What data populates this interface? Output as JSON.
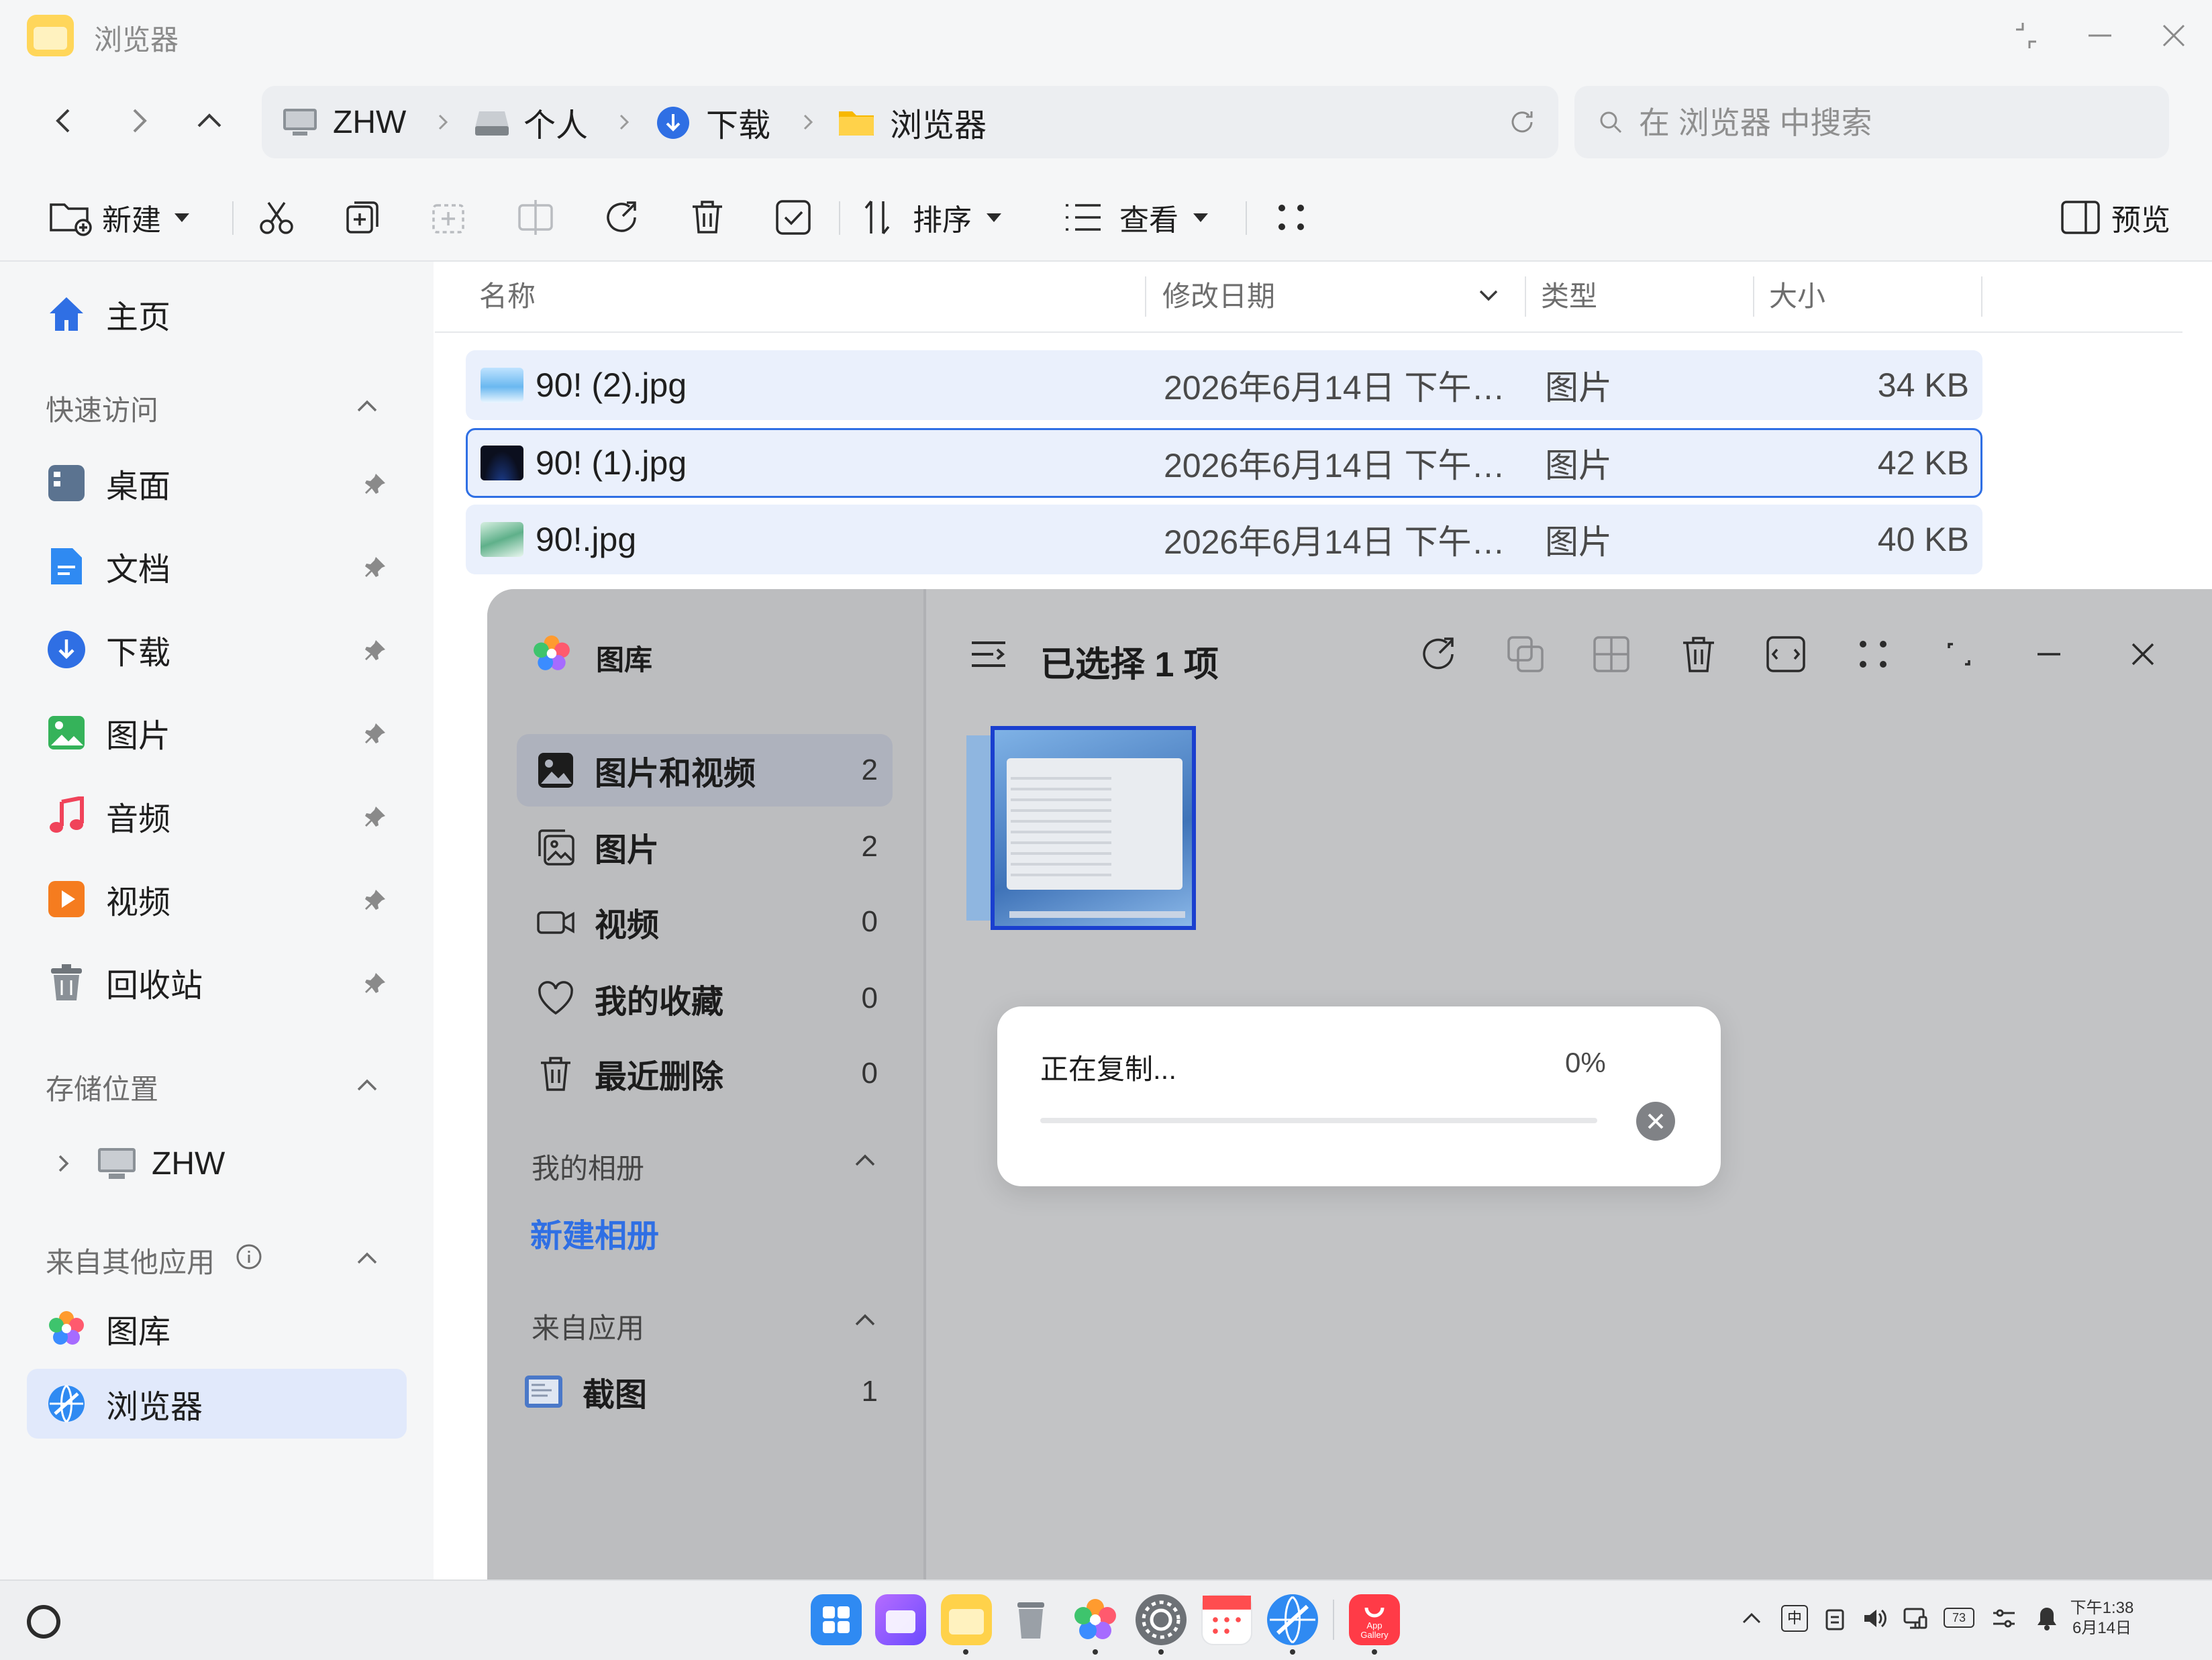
{
  "window": {
    "title": "浏览器"
  },
  "breadcrumb": [
    "ZHW",
    "个人",
    "下载",
    "浏览器"
  ],
  "search": {
    "placeholder": "在 浏览器 中搜索"
  },
  "toolbar": {
    "new_label": "新建",
    "sort_label": "排序",
    "view_label": "查看",
    "preview_label": "预览"
  },
  "sidebar": {
    "home": "主页",
    "quick_access": {
      "title": "快速访问",
      "items": [
        {
          "label": "桌面",
          "icon": "desktop-icon"
        },
        {
          "label": "文档",
          "icon": "document-icon"
        },
        {
          "label": "下载",
          "icon": "download-icon"
        },
        {
          "label": "图片",
          "icon": "image-icon"
        },
        {
          "label": "音频",
          "icon": "music-icon"
        },
        {
          "label": "视频",
          "icon": "video-icon"
        },
        {
          "label": "回收站",
          "icon": "trash-icon"
        }
      ]
    },
    "storage": {
      "title": "存储位置",
      "items": [
        {
          "label": "ZHW"
        }
      ]
    },
    "other_apps": {
      "title": "来自其他应用",
      "items": [
        {
          "label": "图库"
        },
        {
          "label": "浏览器"
        }
      ]
    }
  },
  "columns": {
    "name": "名称",
    "date": "修改日期",
    "type": "类型",
    "size": "大小"
  },
  "files": [
    {
      "name": "90! (2).jpg",
      "date": "2026年6月14日 下午…",
      "type": "图片",
      "size": "34 KB"
    },
    {
      "name": "90! (1).jpg",
      "date": "2026年6月14日 下午…",
      "type": "图片",
      "size": "42 KB"
    },
    {
      "name": "90!.jpg",
      "date": "2026年6月14日 下午…",
      "type": "图片",
      "size": "40 KB"
    }
  ],
  "gallery": {
    "app_name": "图库",
    "selection_title": "已选择 1 项",
    "items": [
      {
        "label": "图片和视频",
        "count": "2"
      },
      {
        "label": "图片",
        "count": "2"
      },
      {
        "label": "视频",
        "count": "0"
      },
      {
        "label": "我的收藏",
        "count": "0"
      },
      {
        "label": "最近删除",
        "count": "0"
      }
    ],
    "my_albums_title": "我的相册",
    "new_album": "新建相册",
    "from_apps_title": "来自应用",
    "app_items": [
      {
        "label": "截图",
        "count": "1"
      }
    ]
  },
  "copy_dialog": {
    "label": "正在复制...",
    "percent": "0%",
    "progress": 0
  },
  "taskbar": {
    "clock_time": "下午1:38",
    "clock_date": "6月14日",
    "ime": "中",
    "battery": "73",
    "appgallery_label_1": "App",
    "appgallery_label_2": "Gallery"
  },
  "colors": {
    "accent": "#2f6fe4",
    "selection": "#eaf0fc",
    "gallery_bg": "#c2c3c5"
  }
}
